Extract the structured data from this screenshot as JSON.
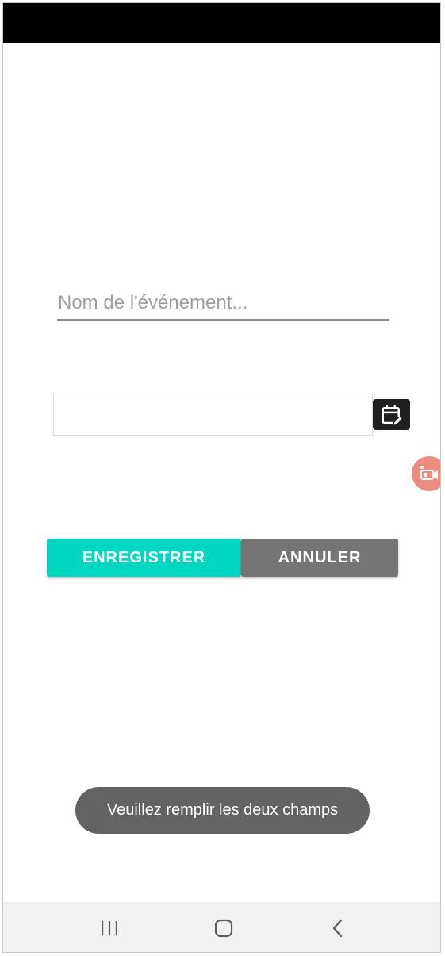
{
  "form": {
    "event_name_placeholder": "Nom de l'événement...",
    "event_name_value": "",
    "date_value": "",
    "calendar_icon": "calendar-edit-icon"
  },
  "actions": {
    "save_label": "ENREGISTRER",
    "cancel_label": "ANNULER"
  },
  "toast": {
    "message": "Veuillez remplir les deux champs"
  },
  "overlay": {
    "record_icon": "screen-record-icon"
  },
  "navigation": {
    "recents_icon": "recent-apps-icon",
    "home_icon": "home-icon",
    "back_icon": "back-icon"
  },
  "colors": {
    "accent": "#00d6c0",
    "cancel": "#757575",
    "toast_bg": "#636363",
    "record_bubble": "#ec8c80"
  }
}
